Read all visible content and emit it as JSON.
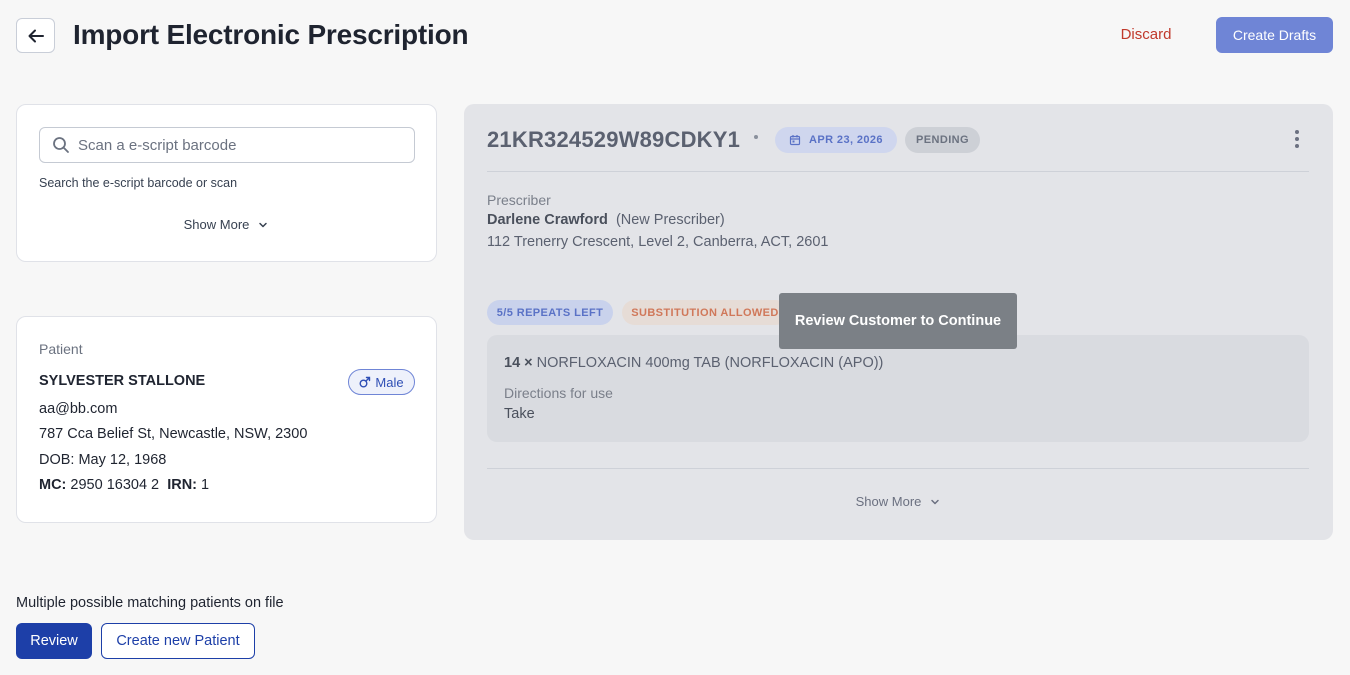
{
  "header": {
    "title": "Import Electronic Prescription",
    "discard_label": "Discard",
    "create_drafts_label": "Create Drafts"
  },
  "search": {
    "placeholder": "Scan a e-script barcode",
    "help_text": "Search the e-script barcode or scan",
    "show_more_label": "Show More"
  },
  "patient": {
    "section_label": "Patient",
    "name": "SYLVESTER STALLONE",
    "gender": "Male",
    "email": "aa@bb.com",
    "address": "787 Cca Belief St, Newcastle, NSW, 2300",
    "dob": "DOB: May 12, 1968",
    "mc_label": "MC:",
    "mc_value": "2950 16304 2",
    "irn_label": "IRN:",
    "irn_value": "1"
  },
  "matching": {
    "message": "Multiple possible matching patients on file",
    "review_label": "Review",
    "create_patient_label": "Create new Patient"
  },
  "prescription": {
    "id": "21KR324529W89CDKY1",
    "date": "APR 23, 2026",
    "status": "PENDING",
    "prescriber_label": "Prescriber",
    "prescriber_name": "Darlene Crawford",
    "prescriber_note": "(New Prescriber)",
    "prescriber_address": "112 Trenerry Crescent, Level 2, Canberra, ACT, 2601",
    "repeats_badge": "5/5 REPEATS LEFT",
    "substitution_badge": "SUBSTITUTION ALLOWED",
    "quantity": "14 ×",
    "medication": "NORFLOXACIN 400mg TAB (NORFLOXACIN (APO))",
    "directions_label": "Directions for use",
    "directions_value": "Take",
    "show_more_label": "Show More"
  },
  "tooltip": {
    "text": "Review Customer to Continue"
  },
  "colors": {
    "primary": "#1d3fa8",
    "accent": "#6f85d6",
    "danger": "#c0392b"
  },
  "icons": [
    "arrow-left-icon",
    "search-icon",
    "chevron-down-icon",
    "male-icon",
    "calendar-icon",
    "kebab-menu-icon"
  ]
}
